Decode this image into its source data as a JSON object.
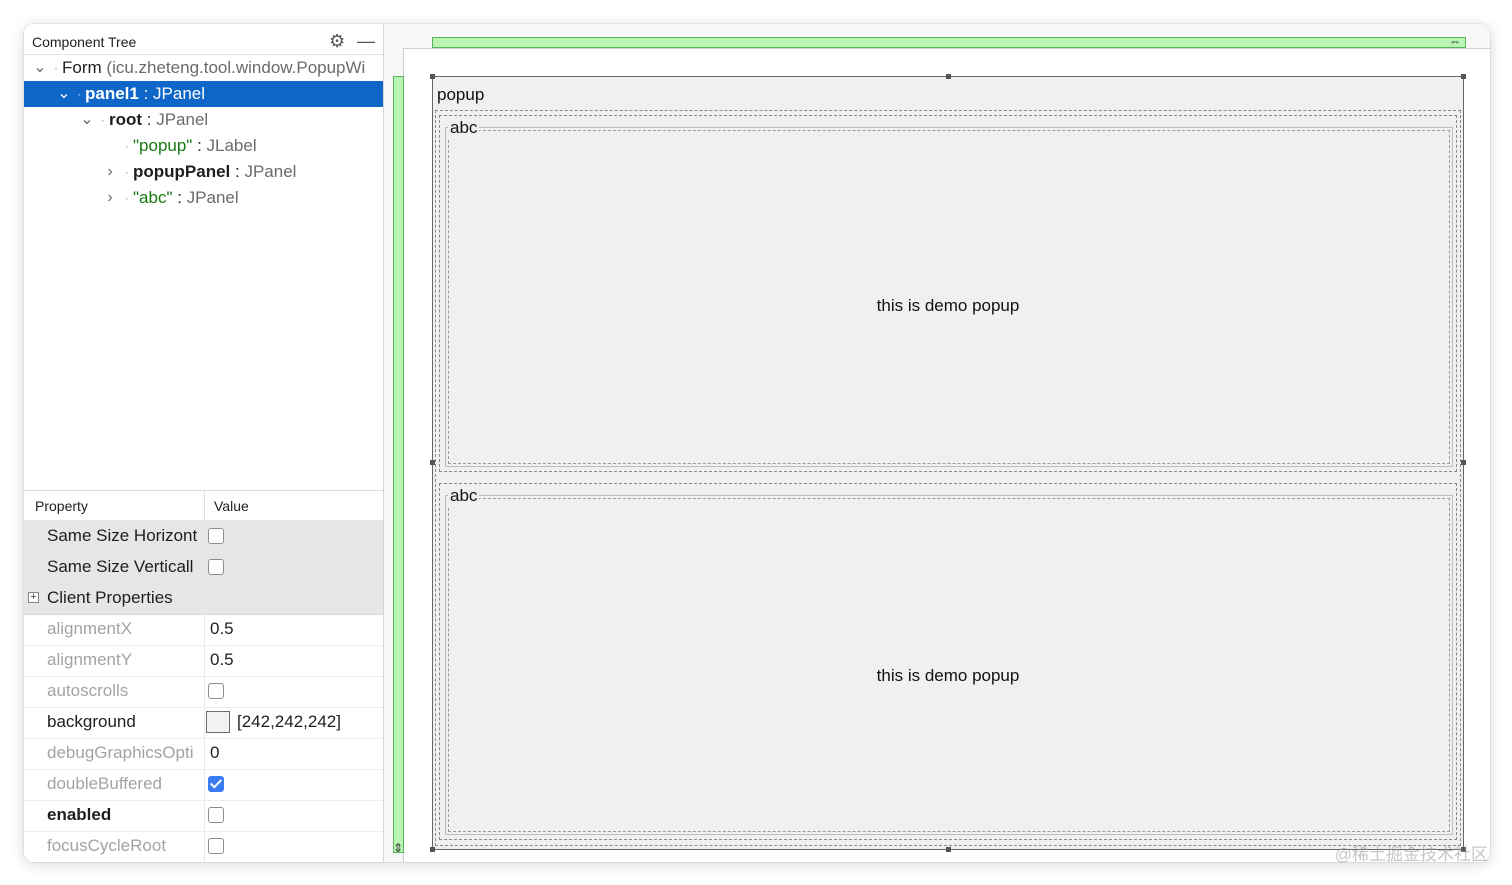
{
  "tree": {
    "title": "Component Tree",
    "header_icons": [
      "gear-icon",
      "minimize-icon"
    ],
    "rows": [
      {
        "name": "Form",
        "type": "(icu.zheteng.tool.window.PopupWi",
        "expanded": true
      },
      {
        "name": "panel1",
        "sep": " : ",
        "type": "JPanel",
        "expanded": true,
        "selected": true
      },
      {
        "name": "root",
        "sep": " : ",
        "type": "JPanel",
        "expanded": true
      },
      {
        "name": "\"popup\"",
        "sep": " : ",
        "type": "JLabel"
      },
      {
        "name": "popupPanel",
        "sep": " : ",
        "type": "JPanel",
        "expanded": false
      },
      {
        "name": "\"abc\"",
        "sep": " : ",
        "type": "JPanel",
        "expanded": false
      }
    ]
  },
  "properties": {
    "header": {
      "property": "Property",
      "value": "Value"
    },
    "rows": [
      {
        "name": "Same Size Horizont",
        "checked": false
      },
      {
        "name": "Same Size Verticall",
        "checked": false
      },
      {
        "name": "Client Properties"
      },
      {
        "name": "alignmentX",
        "value": "0.5"
      },
      {
        "name": "alignmentY",
        "value": "0.5"
      },
      {
        "name": "autoscrolls",
        "checked": false
      },
      {
        "name": "background",
        "value": "[242,242,242]",
        "color": "#f2f2f2"
      },
      {
        "name": "debugGraphicsOpti",
        "value": "0"
      },
      {
        "name": "doubleBuffered",
        "checked": true
      },
      {
        "name": "enabled",
        "checked": false
      },
      {
        "name": "focusCycleRoot",
        "checked": false
      }
    ]
  },
  "designer": {
    "popup_label": "popup",
    "panels": [
      {
        "title": "abc",
        "text": "this is demo popup"
      },
      {
        "title": "abc",
        "text": "this is demo popup"
      }
    ],
    "colors": {
      "strip": "#b9f4b4",
      "selection": "#0f66c9",
      "panel_bg": "#f0f0f0"
    }
  },
  "watermark": "@稀土掘金技术社区"
}
